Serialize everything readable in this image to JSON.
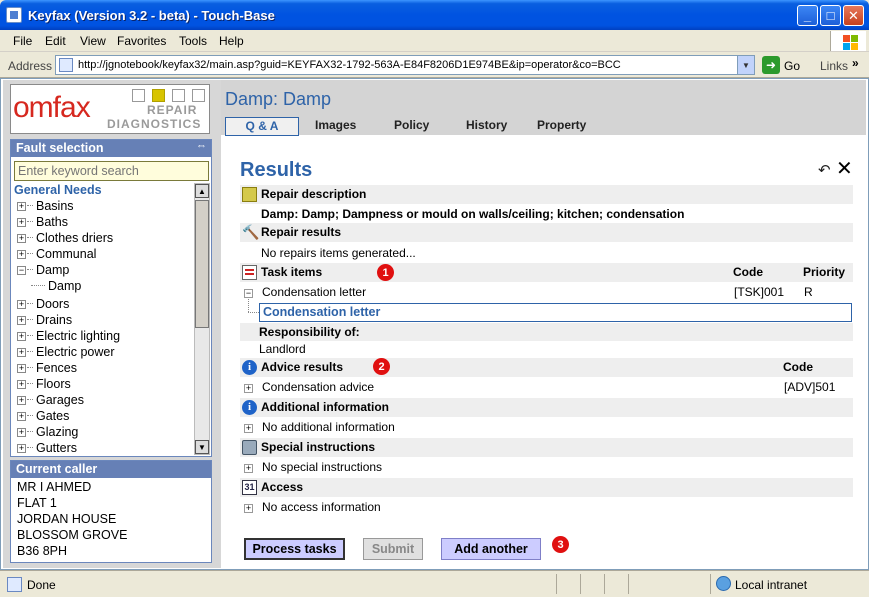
{
  "window": {
    "title": "Keyfax (Version 3.2 - beta) - Touch-Base"
  },
  "menu": [
    "File",
    "Edit",
    "View",
    "Favorites",
    "Tools",
    "Help"
  ],
  "address": {
    "label": "Address",
    "url": "http://jgnotebook/keyfax32/main.asp?guid=KEYFAX32-1792-563A-E84F8206D1E974BE&ip=operator&co=BCC",
    "go_label": "Go",
    "links_label": "Links"
  },
  "logo": {
    "brand": "omfax",
    "line1": "REPAIR",
    "line2": "DIAGNOSTICS"
  },
  "fault_selection": {
    "heading": "Fault selection",
    "search_placeholder": "Enter keyword search",
    "category": "General Needs",
    "items": [
      {
        "label": "Basins",
        "expander": "+"
      },
      {
        "label": "Baths",
        "expander": "+"
      },
      {
        "label": "Clothes driers",
        "expander": "+"
      },
      {
        "label": "Communal",
        "expander": "+"
      },
      {
        "label": "Damp",
        "expander": "−"
      },
      {
        "label": "Damp",
        "expander": ""
      },
      {
        "label": "Doors",
        "expander": "+"
      },
      {
        "label": "Drains",
        "expander": "+"
      },
      {
        "label": "Electric lighting",
        "expander": "+"
      },
      {
        "label": "Electric power",
        "expander": "+"
      },
      {
        "label": "Fences",
        "expander": "+"
      },
      {
        "label": "Floors",
        "expander": "+"
      },
      {
        "label": "Garages",
        "expander": "+"
      },
      {
        "label": "Gates",
        "expander": "+"
      },
      {
        "label": "Glazing",
        "expander": "+"
      },
      {
        "label": "Gutters",
        "expander": "+"
      }
    ]
  },
  "current_caller": {
    "heading": "Current caller",
    "lines": [
      "MR I AHMED",
      "FLAT 1",
      "JORDAN HOUSE",
      "BLOSSOM GROVE",
      "B36 8PH"
    ]
  },
  "header": {
    "title": "Damp: Damp",
    "tabs": [
      "Q & A",
      "Images",
      "Policy",
      "History",
      "Property"
    ]
  },
  "results": {
    "title": "Results",
    "repair_description": {
      "label": "Repair description",
      "text": "Damp: Damp; Dampness or mould on walls/ceiling; kitchen; condensation"
    },
    "repair_results": {
      "label": "Repair results",
      "text": "No repairs items generated..."
    },
    "task_items": {
      "label": "Task items",
      "marker": "1",
      "col_code": "Code",
      "col_priority": "Priority",
      "row": {
        "name": "Condensation letter",
        "code": "[TSK]001",
        "priority": "R"
      },
      "expanded_title": "Condensation letter",
      "responsibility_label": "Responsibility of:",
      "responsibility_value": "Landlord"
    },
    "advice_results": {
      "label": "Advice results",
      "marker": "2",
      "col_code": "Code",
      "row": {
        "name": "Condensation advice",
        "code": "[ADV]501"
      }
    },
    "additional_information": {
      "label": "Additional information",
      "text": "No additional information"
    },
    "special_instructions": {
      "label": "Special instructions",
      "text": "No special instructions"
    },
    "access": {
      "label": "Access",
      "icon_text": "31",
      "text": "No access information"
    }
  },
  "buttons": {
    "process": "Process tasks",
    "submit": "Submit",
    "another": "Add another",
    "marker": "3"
  },
  "status": {
    "text": "Done",
    "zone": "Local intranet"
  }
}
